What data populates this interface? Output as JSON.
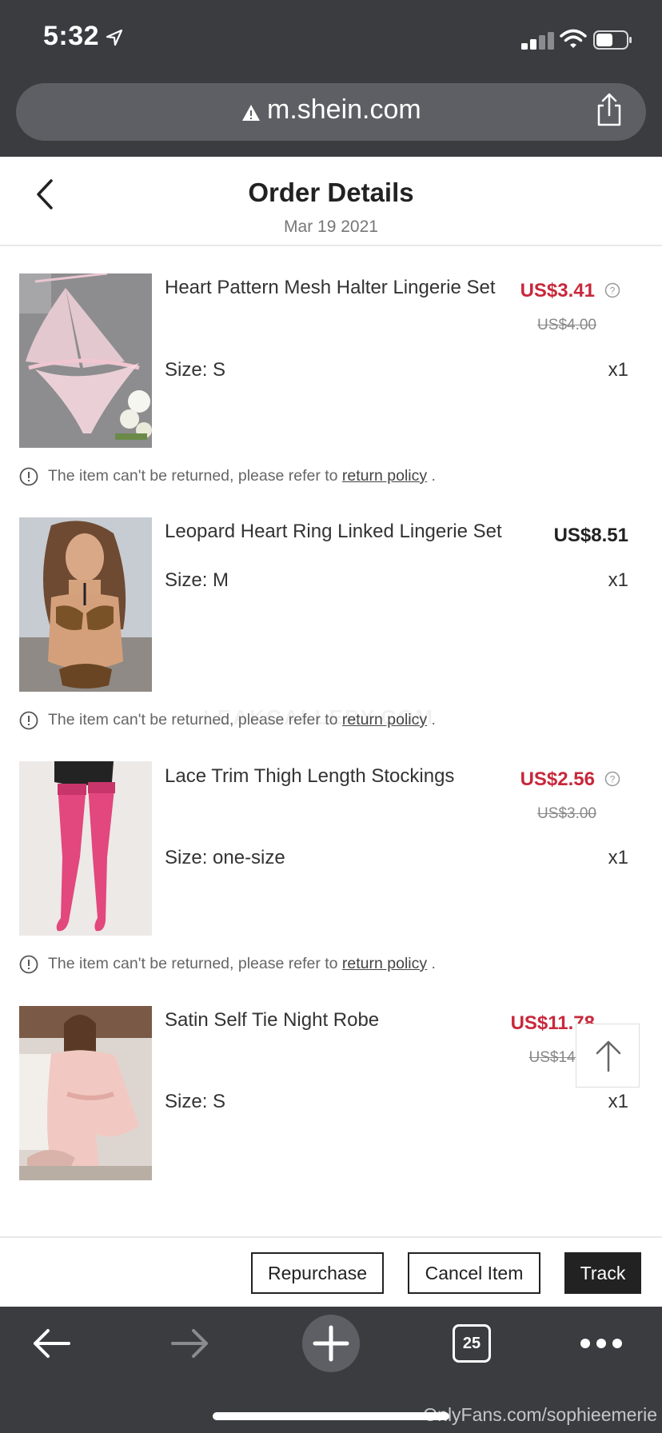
{
  "status_bar": {
    "time": "5:32"
  },
  "browser": {
    "url": "m.shein.com",
    "tab_count": "25"
  },
  "header": {
    "title": "Order Details",
    "date": "Mar 19 2021"
  },
  "items": [
    {
      "name": "Heart Pattern Mesh Halter Lingerie Set",
      "size": "Size: S",
      "price": "US$3.41",
      "original_price": "US$4.00",
      "qty": "x1",
      "on_sale": true
    },
    {
      "name": "Leopard Heart Ring Linked Lingerie Set",
      "size": "Size: M",
      "price": "US$8.51",
      "original_price": "",
      "qty": "x1",
      "on_sale": false
    },
    {
      "name": "Lace Trim Thigh Length Stockings",
      "size": "Size: one-size",
      "price": "US$2.56",
      "original_price": "US$3.00",
      "qty": "x1",
      "on_sale": true
    },
    {
      "name": "Satin Self Tie Night Robe",
      "size": "Size: S",
      "price": "US$11.78",
      "original_price": "US$14.00",
      "qty": "x1",
      "on_sale": true
    }
  ],
  "notice": {
    "text": "The item can't be returned, please refer to ",
    "link": "return policy",
    "suffix": " ."
  },
  "actions": {
    "repurchase": "Repurchase",
    "cancel_item": "Cancel Item",
    "track": "Track"
  },
  "watermarks": {
    "bottom": "OnlyFans.com/sophieemerie",
    "middle": "LEAKGALLERY.COM"
  },
  "colors": {
    "sale_price": "#c8283c",
    "chrome": "#3b3c40",
    "primary_button": "#222222"
  },
  "icons": [
    "location-arrow-icon",
    "cellular-signal-icon",
    "wifi-icon",
    "battery-icon",
    "warning-icon",
    "share-icon",
    "back-chevron-icon",
    "help-icon",
    "info-circle-icon",
    "arrow-up-icon",
    "arrow-left-icon",
    "arrow-right-icon",
    "plus-icon",
    "tabs-icon",
    "more-icon"
  ]
}
